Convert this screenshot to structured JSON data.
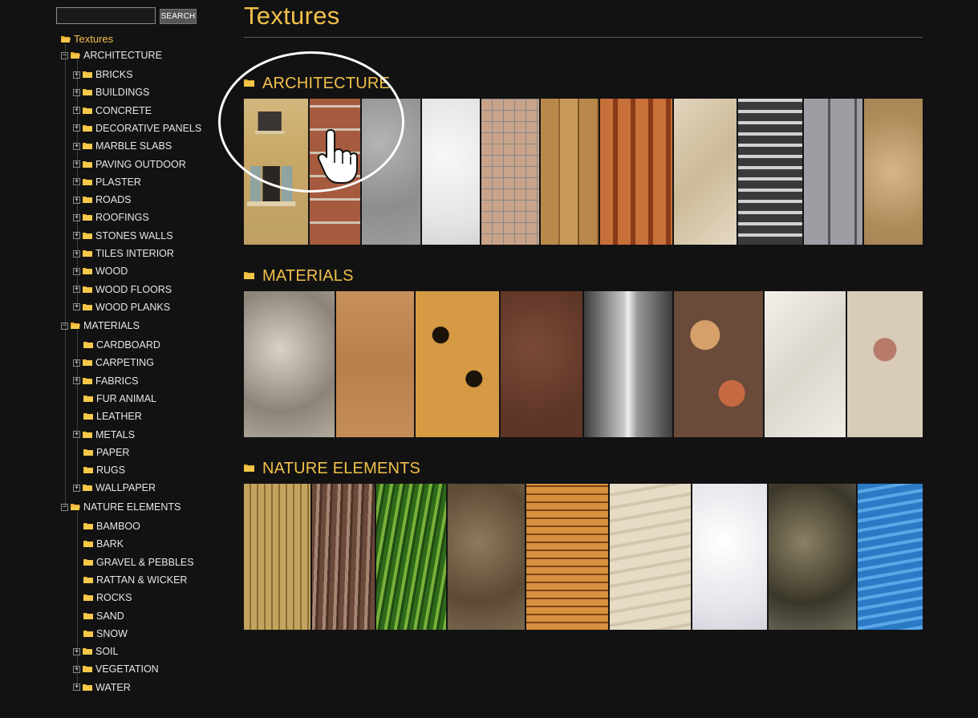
{
  "search": {
    "placeholder": "",
    "button_label": "SEARCH"
  },
  "page": {
    "title": "Textures"
  },
  "tree": {
    "root": "Textures",
    "groups": [
      {
        "label": "ARCHITECTURE",
        "items": [
          {
            "label": "BRICKS",
            "expandable": true
          },
          {
            "label": "BUILDINGS",
            "expandable": true
          },
          {
            "label": "CONCRETE",
            "expandable": true
          },
          {
            "label": "DECORATIVE PANELS",
            "expandable": true
          },
          {
            "label": "MARBLE SLABS",
            "expandable": true
          },
          {
            "label": "PAVING OUTDOOR",
            "expandable": true
          },
          {
            "label": "PLASTER",
            "expandable": true
          },
          {
            "label": "ROADS",
            "expandable": true
          },
          {
            "label": "ROOFINGS",
            "expandable": true
          },
          {
            "label": "STONES WALLS",
            "expandable": true
          },
          {
            "label": "TILES INTERIOR",
            "expandable": true
          },
          {
            "label": "WOOD",
            "expandable": true
          },
          {
            "label": "WOOD FLOORS",
            "expandable": true
          },
          {
            "label": "WOOD PLANKS",
            "expandable": true
          }
        ]
      },
      {
        "label": "MATERIALS",
        "items": [
          {
            "label": "CARDBOARD",
            "expandable": false
          },
          {
            "label": "CARPETING",
            "expandable": true
          },
          {
            "label": "FABRICS",
            "expandable": true
          },
          {
            "label": "FUR ANIMAL",
            "expandable": false
          },
          {
            "label": "LEATHER",
            "expandable": false
          },
          {
            "label": "METALS",
            "expandable": true
          },
          {
            "label": "PAPER",
            "expandable": false
          },
          {
            "label": "RUGS",
            "expandable": false
          },
          {
            "label": "WALLPAPER",
            "expandable": true
          }
        ]
      },
      {
        "label": "NATURE ELEMENTS",
        "items": [
          {
            "label": "BAMBOO",
            "expandable": false
          },
          {
            "label": "BARK",
            "expandable": false
          },
          {
            "label": "GRAVEL & PEBBLES",
            "expandable": false
          },
          {
            "label": "RATTAN & WICKER",
            "expandable": false
          },
          {
            "label": "ROCKS",
            "expandable": false
          },
          {
            "label": "SAND",
            "expandable": false
          },
          {
            "label": "SNOW",
            "expandable": false
          },
          {
            "label": "SOIL",
            "expandable": true
          },
          {
            "label": "VEGETATION",
            "expandable": true
          },
          {
            "label": "WATER",
            "expandable": true
          }
        ]
      }
    ]
  },
  "sections": [
    {
      "label": "ARCHITECTURE",
      "tiles": [
        {
          "name": "building-facade",
          "css": "linear-gradient(#d2b77d,#c9a866 40%,#bfa065)"
        },
        {
          "name": "bricks",
          "css": "repeating-linear-gradient(0deg,#a65a3e 0 26px,#cfc3b0 26px 29px),#a65a3e"
        },
        {
          "name": "concrete",
          "css": "radial-gradient(circle at 30% 30%,#b4b4b4,#8d8d8d 60%,#9c9c9c)"
        },
        {
          "name": "plaster-white",
          "css": "radial-gradient(circle at 40% 40%,#f8f8f8,#e4e4e4 70%,#d6d6d6)"
        },
        {
          "name": "mosaic-tiles",
          "css": "repeating-linear-gradient(90deg,transparent 0 13px,#888 13px 14px),repeating-linear-gradient(0deg,#c9a38a 0 13px,#888 13px 14px),#e8dcd0"
        },
        {
          "name": "wood-planks",
          "css": "repeating-linear-gradient(90deg,#b9894c 0 22px,#8e632e 22px 24px,#c79a58 24px 46px,#7a5428 46px 48px)"
        },
        {
          "name": "roof-tiles",
          "css": "repeating-linear-gradient(90deg,#c8703a 0 16px,#8a3a18 16px 22px),#b55d2b"
        },
        {
          "name": "marble",
          "css": "linear-gradient(135deg,#e2d5bd,#cbb998 50%,#e6dac4)"
        },
        {
          "name": "road-crossing",
          "css": "repeating-linear-gradient(0deg,#3a3a3a 0 10px,#d2d2d2 10px 14px),#404040"
        },
        {
          "name": "paving-stones",
          "css": "repeating-linear-gradient(90deg,#9c9ea4 0 30px,#505258 30px 33px),#8e9096"
        },
        {
          "name": "stone-wall",
          "css": "radial-gradient(circle at 50% 50%,#d6b588,#b08c5c 70%,#a98456)"
        }
      ]
    },
    {
      "label": "MATERIALS",
      "tiles": [
        {
          "name": "carpet-shag",
          "css": "radial-gradient(circle at 40% 40%,#d8d2c6,#8c8478 60%,#b2aa9c)"
        },
        {
          "name": "cardboard",
          "css": "linear-gradient(#c8905a,#b97f4a 50%,#c58d58)"
        },
        {
          "name": "leopard-fur",
          "css": "radial-gradient(circle at 30% 30%,#1b120a 0 10px,transparent 11px),radial-gradient(circle at 70% 60%,#1b120a 0 10px,transparent 11px),#d69a44"
        },
        {
          "name": "leather",
          "css": "radial-gradient(circle at 40% 40%,#7a4a38,#5e3526 70%)"
        },
        {
          "name": "metal",
          "css": "linear-gradient(90deg,#3c3c3c,#c8c8c8 45%,#f0f0f0 50%,#9a9a9a 60%,#3c3c3c)"
        },
        {
          "name": "floral-fabric",
          "css": "radial-gradient(circle at 35% 30%,#d6a06a 0 18px,transparent 19px),radial-gradient(circle at 65% 70%,#c76a44 0 16px,transparent 17px),#6a4a38"
        },
        {
          "name": "paper",
          "css": "linear-gradient(135deg,#f3f0ea,#dcd7cd 50%,#f0ece4)"
        },
        {
          "name": "wallpaper",
          "css": "radial-gradient(circle at 50% 40%,#b87a6a 0 14px,transparent 15px),#d8cbb8"
        }
      ]
    },
    {
      "label": "NATURE ELEMENTS",
      "tiles": [
        {
          "name": "bamboo",
          "css": "repeating-linear-gradient(90deg,#c2a45e 0 7px,#8c6c34 7px 9px),#b39653"
        },
        {
          "name": "bark",
          "css": "repeating-linear-gradient(92deg,#6a4a3a 0 6px,#a48672 6px 10px,#4a3226 10px 13px)"
        },
        {
          "name": "grass",
          "css": "repeating-linear-gradient(100deg,#2f6a1a 0 5px,#78b03a 5px 9px,#1f4a12 9px 12px)"
        },
        {
          "name": "soil",
          "css": "radial-gradient(circle at 40% 40%,#8e7a5e,#5c4a34 60%,#7a6850)"
        },
        {
          "name": "wicker",
          "css": "repeating-linear-gradient(0deg,#d6903e 0 8px,#7a4418 8px 10px),#c98436"
        },
        {
          "name": "sand",
          "css": "repeating-linear-gradient(170deg,#e6dcc6 0 12px,#d2c6ac 12px 16px),#ded4bc"
        },
        {
          "name": "snow",
          "css": "radial-gradient(circle at 40% 40%,#ffffff,#e4e4ea 70%,#d4d4de)"
        },
        {
          "name": "rock",
          "css": "radial-gradient(circle at 40% 40%,#8a8064,#3a3628 60%,#6e6a5a)"
        },
        {
          "name": "water",
          "css": "repeating-linear-gradient(170deg,#2a7ac6 0 8px,#5aa6e6 8px 12px),#2f82cf"
        }
      ]
    }
  ]
}
